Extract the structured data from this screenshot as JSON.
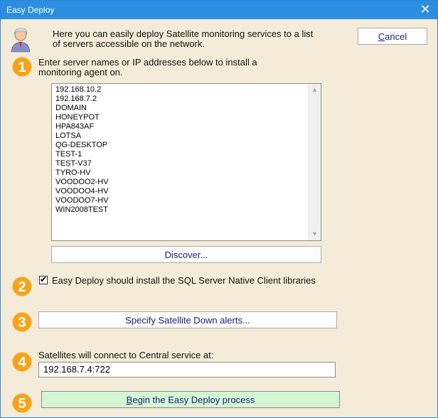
{
  "window": {
    "title": "Easy Deploy",
    "close_glyph": "✕"
  },
  "intro": {
    "line1": "Here you can easily deploy Satellite monitoring services to a list",
    "line2": "of servers accessible on the network.",
    "icon": "user-avatar-icon"
  },
  "cancel_button": {
    "pre": "",
    "accel": "C",
    "post": "ancel"
  },
  "step1": {
    "number": "1",
    "line1": "Enter server names or IP addresses below to install a",
    "line2": "monitoring agent on.",
    "servers": [
      "192.168.10.2",
      "192.168.7.2",
      "DOMAIN",
      "HONEYPOT",
      "HPA843AF",
      "LOTSA",
      "QG-DESKTOP",
      "TEST-1",
      "TEST-V37",
      "TYRO-HV",
      "VOODOO2-HV",
      "VOODOO4-HV",
      "VOODOO7-HV",
      "WIN2008TEST"
    ],
    "discover_label": "Discover..."
  },
  "step2": {
    "number": "2",
    "checked": true,
    "check_glyph": "✔",
    "label": "Easy Deploy should install the SQL Server Native Client libraries"
  },
  "step3": {
    "number": "3",
    "button_label": "Specify Satellite Down alerts..."
  },
  "step4": {
    "number": "4",
    "label": "Satellites will connect to Central service at:",
    "address": "192.168.7.4:722"
  },
  "step5": {
    "number": "5",
    "button": {
      "pre": "",
      "accel": "B",
      "post": "egin the Easy Deploy process"
    }
  },
  "colors": {
    "accent": "#f5a31a",
    "titlebar": "#2c8ee0",
    "background": "#f4ecd9",
    "begin_button": "#d4f7d3"
  }
}
